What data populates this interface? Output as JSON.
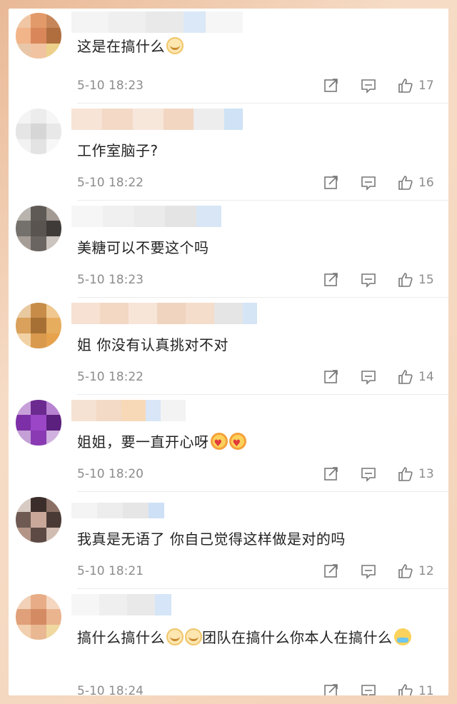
{
  "colors": {
    "accent": "#f4d3b8",
    "text": "#222222",
    "meta": "#8c8c8c"
  },
  "icons": {
    "share": "share-icon",
    "reply": "comment-icon",
    "like": "thumbs-up-icon"
  },
  "comments": [
    {
      "text": "这是在搞什么",
      "emoji": [
        "grin"
      ],
      "time": "5-10 18:23",
      "likes": "17"
    },
    {
      "text": "工作室脑子?",
      "emoji": [],
      "time": "5-10 18:22",
      "likes": "16"
    },
    {
      "text": "美糖可以不要这个吗",
      "emoji": [],
      "time": "5-10 18:23",
      "likes": "15"
    },
    {
      "text": "姐 你没有认真挑对不对",
      "emoji": [],
      "time": "5-10 18:22",
      "likes": "14"
    },
    {
      "text": "姐姐，要一直开心呀",
      "emoji": [
        "heart",
        "heart"
      ],
      "time": "5-10 18:20",
      "likes": "13"
    },
    {
      "text": "我真是无语了 你自己觉得这样做是对的吗",
      "emoji": [],
      "time": "5-10 18:21",
      "likes": "12"
    },
    {
      "text": "搞什么搞什么",
      "emoji": [
        "grin",
        "grin"
      ],
      "text2": "团队在搞什么你本人在搞什么",
      "emoji2": [
        "cry"
      ],
      "time": "5-10 18:24",
      "likes": "11"
    }
  ]
}
